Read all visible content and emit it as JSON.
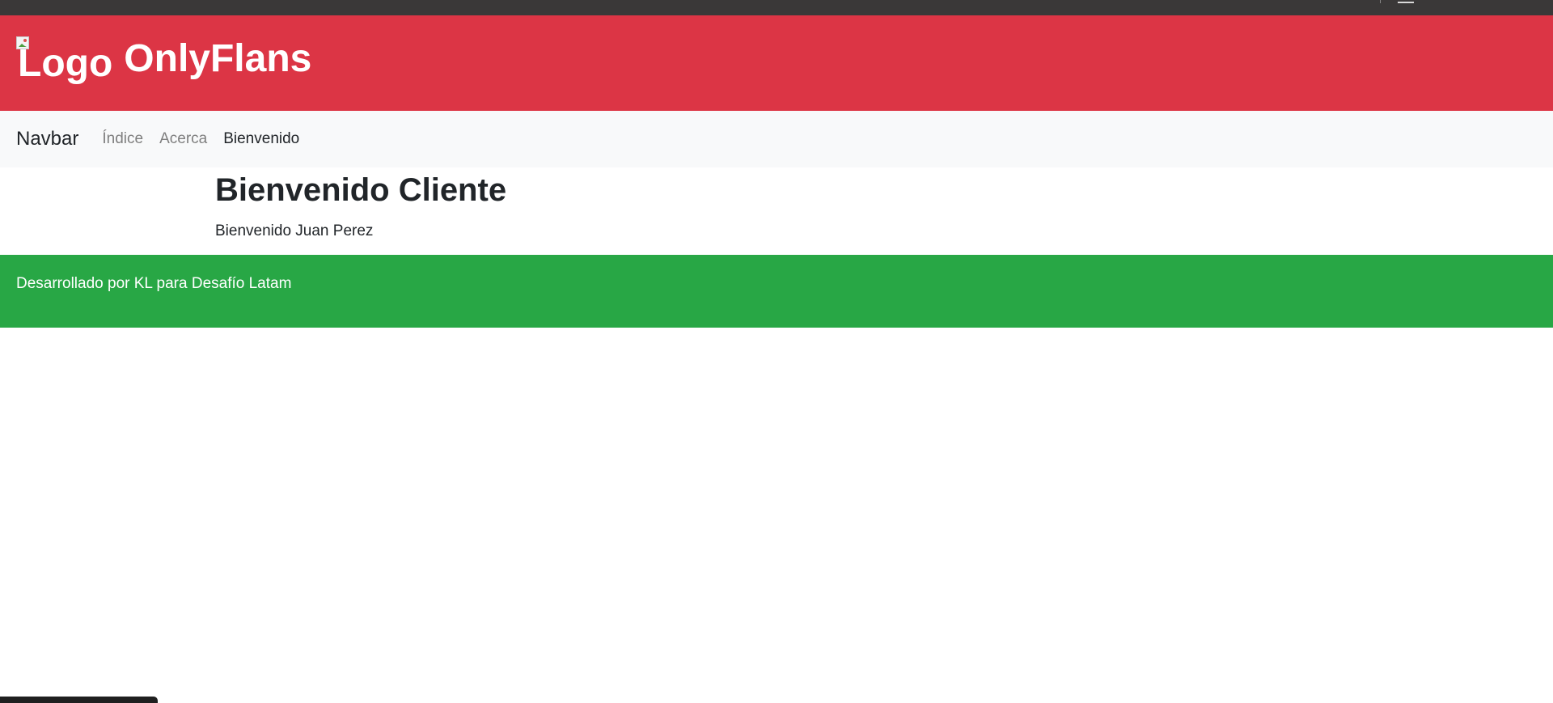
{
  "header": {
    "logo_alt": "Logo",
    "site_title": "OnlyFlans"
  },
  "navbar": {
    "brand": "Navbar",
    "links": [
      {
        "label": "Índice",
        "active": false
      },
      {
        "label": "Acerca",
        "active": false
      },
      {
        "label": "Bienvenido",
        "active": true
      }
    ]
  },
  "main": {
    "title": "Bienvenido Cliente",
    "welcome_text": "Bienvenido Juan Perez"
  },
  "footer": {
    "text": "Desarrollado por KL para Desafío Latam"
  },
  "colors": {
    "header_bg": "#dc3545",
    "navbar_bg": "#f8f9fa",
    "footer_bg": "#28a745",
    "top_bar_bg": "#3a3838"
  },
  "icons": {
    "broken_image": "broken-image-icon"
  }
}
